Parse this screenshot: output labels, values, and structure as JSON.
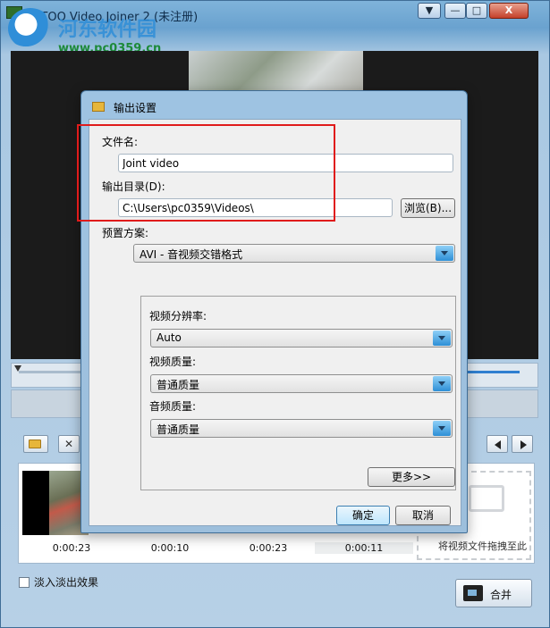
{
  "window": {
    "title": "...TOO Video Joiner 2 (未注册)",
    "controls": {
      "menu": "▼",
      "minimize": "—",
      "maximize": "□",
      "close": "X"
    }
  },
  "watermark": {
    "title": "河东软件园",
    "url": "www.pc0359.cn"
  },
  "dialog": {
    "title": "输出设置",
    "filename_label": "文件名:",
    "filename_value": "Joint video",
    "output_dir_label": "输出目录(D):",
    "output_dir_value": "C:\\Users\\pc0359\\Videos\\",
    "browse_label": "浏览(B)...",
    "preset_label": "预置方案:",
    "preset_value": "AVI - 音视频交错格式",
    "video_resolution_label": "视频分辨率:",
    "video_resolution_value": "Auto",
    "video_quality_label": "视频质量:",
    "video_quality_value": "普通质量",
    "audio_quality_label": "音频质量:",
    "audio_quality_value": "普通质量",
    "more_label": "更多>>",
    "ok_label": "确定",
    "cancel_label": "取消"
  },
  "clips": {
    "times": [
      "0:00:23",
      "0:00:10",
      "0:00:23",
      "0:00:11"
    ],
    "drop_text": "将视频文件拖拽至此"
  },
  "fade_label": "淡入淡出效果",
  "merge_label": "合并",
  "colors": {
    "highlight": "#e01b1b",
    "accent": "#2d8fd6"
  },
  "icons": {
    "toolbar_add": "folder-icon",
    "toolbar_remove": "close-icon",
    "nav_prev": "triangle-left-icon",
    "nav_next": "triangle-right-icon",
    "merge": "film-icon"
  }
}
